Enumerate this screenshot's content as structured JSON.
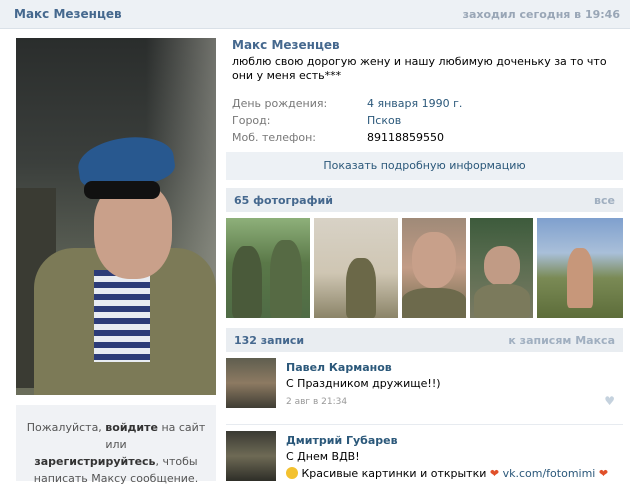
{
  "header": {
    "name": "Макс Мезенцев",
    "last_seen": "заходил сегодня в 19:46"
  },
  "sidebar": {
    "login_prompt": {
      "part1": "Пожалуйста, ",
      "login_link": "войдите",
      "part2": " на сайт или",
      "register_link": "зарегистрируйтесь",
      "part3": ", чтобы",
      "part4": "написать Максу сообщение."
    }
  },
  "profile": {
    "name": "Макс Мезенцев",
    "status": "люблю свою дорогую жену и нашу любимую доченьку за то что они у меня есть***",
    "info": [
      {
        "label": "День рождения:",
        "value": "4 января 1990 г."
      },
      {
        "label": "Город:",
        "value": "Псков"
      },
      {
        "label": "Моб. телефон:",
        "value": "89118859550"
      }
    ],
    "more_button": "Показать подробную информацию"
  },
  "photos": {
    "title": "65 фотографий",
    "all_link": "все"
  },
  "wall": {
    "title": "132 записи",
    "to_posts_link": "к записям Макса",
    "posts": [
      {
        "author": "Павел Карманов",
        "text": "С Праздником дружище!!)",
        "date": "2 авг в 21:34"
      },
      {
        "author": "Дмитрий Губарев",
        "text": "С Днем ВДВ!",
        "extra_text": "Красивые картинки и открытки",
        "link": "vk.com/fotomimi"
      }
    ]
  },
  "icons": {
    "like": "heart-icon",
    "heart_emoji": "heart-emoji-icon",
    "smile_emoji": "smile-emoji-icon"
  },
  "colors": {
    "link": "#2b587a",
    "header_bg": "#edf1f5",
    "muted": "#999999"
  }
}
